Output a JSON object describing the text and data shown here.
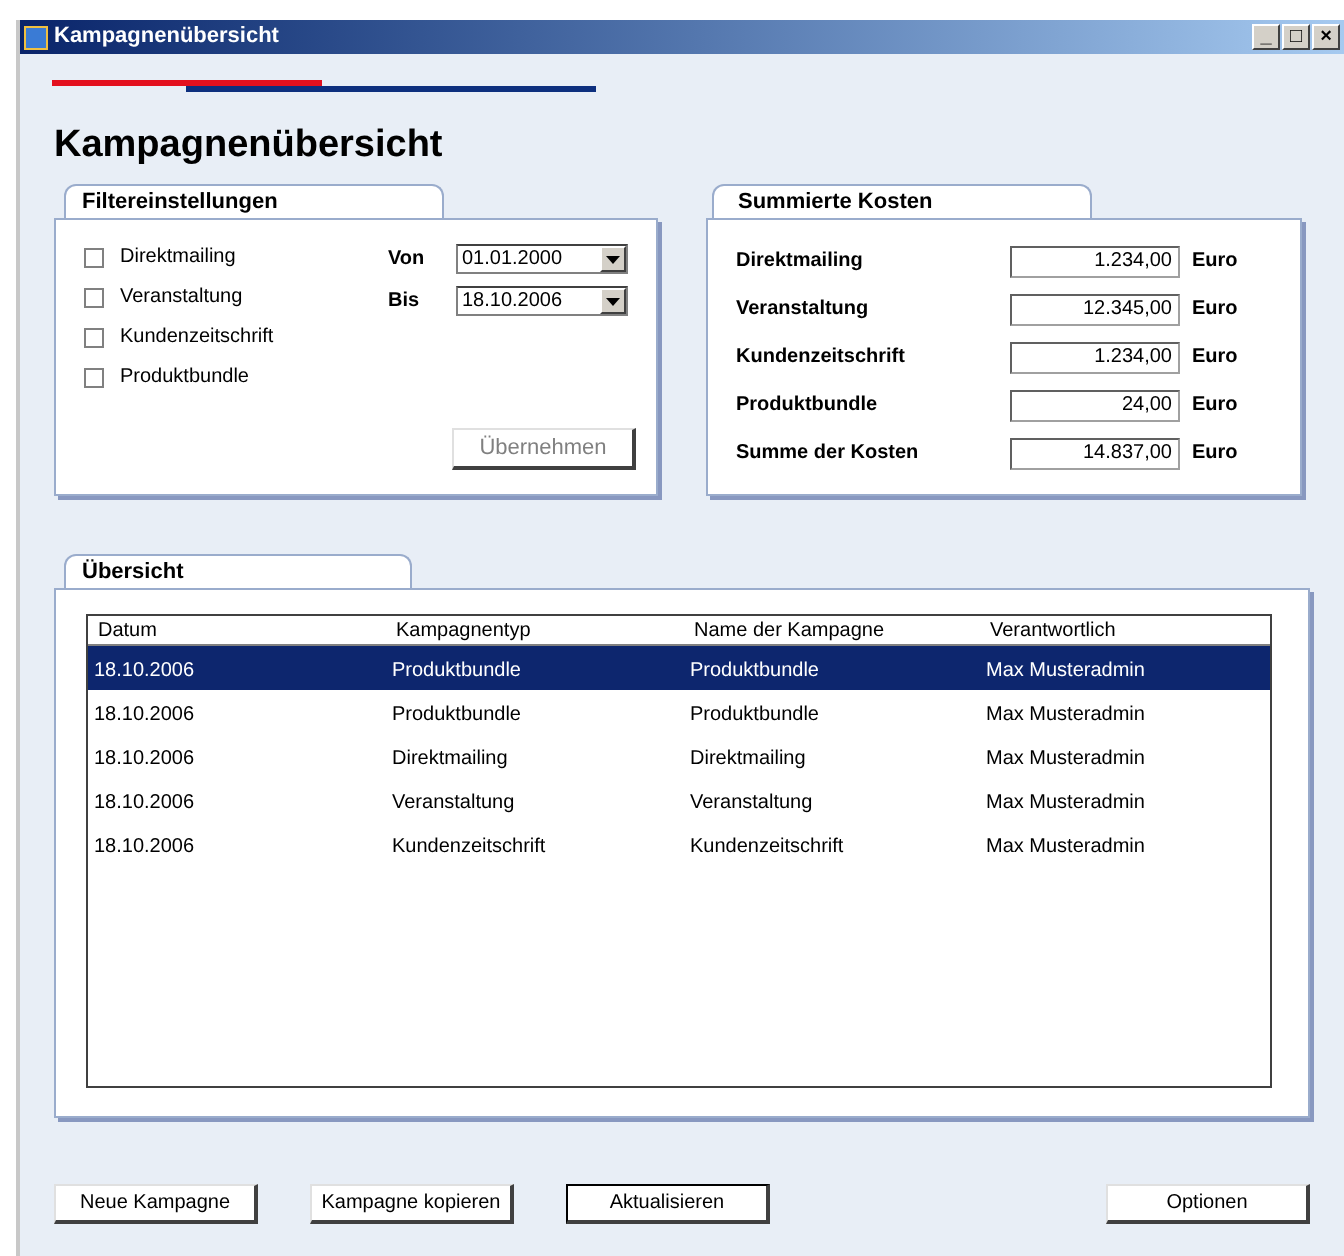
{
  "window": {
    "title": "Kampagnenübersicht",
    "controls": [
      "_",
      "□",
      "×"
    ]
  },
  "heading": "Kampagnenübersicht",
  "filter": {
    "title": "Filtereinstellungen",
    "checkboxes": [
      {
        "label": "Direktmailing",
        "checked": false
      },
      {
        "label": "Veranstaltung",
        "checked": false
      },
      {
        "label": "Kundenzeitschrift",
        "checked": false
      },
      {
        "label": "Produktbundle",
        "checked": false
      }
    ],
    "dates": [
      {
        "label": "Von",
        "value": "01.01.2000"
      },
      {
        "label": "Bis",
        "value": "18.10.2006"
      }
    ],
    "apply_button": {
      "label": "Übernehmen",
      "disabled": true
    }
  },
  "costs": {
    "title": "Summierte Kosten",
    "rows": [
      {
        "label": "Direktmailing",
        "value": "1.234,00",
        "unit": "Euro"
      },
      {
        "label": "Veranstaltung",
        "value": "12.345,00",
        "unit": "Euro"
      },
      {
        "label": "Kundenzeitschrift",
        "value": "1.234,00",
        "unit": "Euro"
      },
      {
        "label": "Produktbundle",
        "value": "24,00",
        "unit": "Euro"
      },
      {
        "label": "Summe der Kosten",
        "value": "14.837,00",
        "unit": "Euro"
      }
    ]
  },
  "overview": {
    "title": "Übersicht",
    "columns": [
      "Datum",
      "Kampagnentyp",
      "Name der Kampagne",
      "Verantwortlich"
    ],
    "rows": [
      {
        "cells": [
          "18.10.2006",
          "Produktbundle",
          "Produktbundle",
          "Max Musteradmin"
        ],
        "selected": true
      },
      {
        "cells": [
          "18.10.2006",
          "Produktbundle",
          "Produktbundle",
          "Max Musteradmin"
        ],
        "selected": false
      },
      {
        "cells": [
          "18.10.2006",
          "Direktmailing",
          "Direktmailing",
          "Max Musteradmin"
        ],
        "selected": false
      },
      {
        "cells": [
          "18.10.2006",
          "Veranstaltung",
          "Veranstaltung",
          "Max Musteradmin"
        ],
        "selected": false
      },
      {
        "cells": [
          "18.10.2006",
          "Kundenzeitschrift",
          "Kundenzeitschrift",
          "Max Musteradmin"
        ],
        "selected": false
      }
    ]
  },
  "buttons": [
    {
      "label": "Neue Kampagne",
      "default": false
    },
    {
      "label": "Kampagne kopieren",
      "default": false
    },
    {
      "label": "Aktualisieren",
      "default": true
    },
    {
      "label": "Optionen",
      "default": false
    }
  ]
}
